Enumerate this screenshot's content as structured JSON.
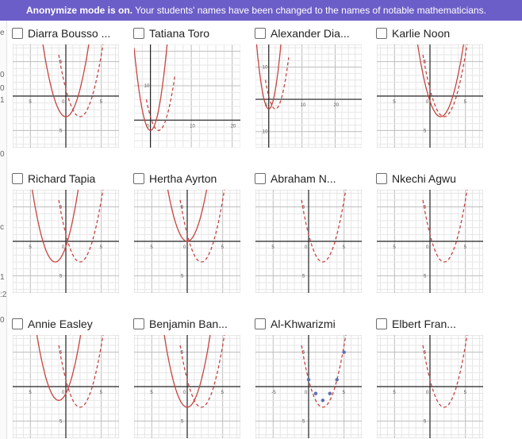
{
  "banner": {
    "bold": "Anonymize mode is on.",
    "rest": " Your students' names have been changed to the names of notable mathematicians."
  },
  "left_strip_chars": [
    "e",
    "0",
    "0",
    "1",
    "0",
    "c",
    "1",
    ":2",
    "0"
  ],
  "colors": {
    "banner": "#6c5ec8",
    "curve": "#c74440",
    "point": "#5b6fb3",
    "grid_minor": "#e6e6e6",
    "grid_major": "#bdbdbd"
  },
  "students": [
    {
      "name": "Diarra Bousso ...",
      "graph": {
        "student_vertex": [
          0,
          -3
        ],
        "ticks_x": [
          "5",
          "0",
          "5"
        ],
        "ticks_y": [
          "5",
          "5"
        ]
      }
    },
    {
      "name": "Tatiana Toro",
      "graph": {
        "student_vertex": [
          0,
          -3
        ],
        "ticks_x": [
          "0",
          "10",
          "20"
        ],
        "ticks_y": [
          "10"
        ]
      }
    },
    {
      "name": "Alexander Dia...",
      "graph": {
        "student_vertex": [
          0,
          -3
        ],
        "ticks_x": [
          "0",
          "10",
          "20"
        ],
        "ticks_y": [
          "10",
          "10"
        ]
      }
    },
    {
      "name": "Karlie Noon",
      "graph": {
        "student_vertex": [
          1.5,
          -3
        ],
        "ticks_x": [
          "5",
          "0",
          "5"
        ],
        "ticks_y": [
          "5",
          "5"
        ]
      }
    },
    {
      "name": "Richard Tapia",
      "graph": {
        "student_vertex": [
          -1.5,
          -3
        ],
        "ticks_x": [
          "5",
          "0",
          "5"
        ],
        "ticks_y": [
          "5",
          "5"
        ]
      }
    },
    {
      "name": "Hertha Ayrton",
      "graph": {
        "student_vertex": [
          0,
          0
        ],
        "ticks_x": [
          "5",
          "0",
          "5"
        ],
        "ticks_y": [
          "5",
          "5"
        ]
      }
    },
    {
      "name": "Abraham N...",
      "graph": {
        "student_vertex": null,
        "ticks_x": [
          "5",
          "0",
          "5"
        ],
        "ticks_y": [
          "5",
          "5"
        ]
      }
    },
    {
      "name": "Nkechi Agwu",
      "graph": {
        "student_vertex": null,
        "ticks_x": [
          "5",
          "0",
          "5"
        ],
        "ticks_y": [
          "5",
          "5"
        ]
      }
    },
    {
      "name": "Annie Easley",
      "graph": {
        "student_vertex": [
          -1,
          -2
        ],
        "ticks_x": [
          "5",
          "0",
          "5"
        ],
        "ticks_y": [
          "5",
          "5"
        ]
      }
    },
    {
      "name": "Benjamin Ban...",
      "graph": {
        "student_vertex": [
          0,
          -3
        ],
        "ticks_x": [
          "5",
          "0",
          "5"
        ],
        "ticks_y": [
          "5",
          "5"
        ]
      }
    },
    {
      "name": "Al-Khwarizmi",
      "graph": {
        "student_vertex": null,
        "points": [
          [
            0,
            1
          ],
          [
            1,
            -1
          ],
          [
            2,
            -2
          ],
          [
            3,
            -1
          ],
          [
            4,
            1
          ],
          [
            5,
            5
          ]
        ],
        "ticks_x": [
          "0",
          "-5",
          "0",
          "5"
        ],
        "ticks_y": [
          "5",
          "5"
        ]
      }
    },
    {
      "name": "Elbert Fran...",
      "graph": {
        "student_vertex": null,
        "ticks_x": [
          "5",
          "0",
          "5"
        ],
        "ticks_y": [
          "5",
          "5"
        ]
      }
    }
  ]
}
